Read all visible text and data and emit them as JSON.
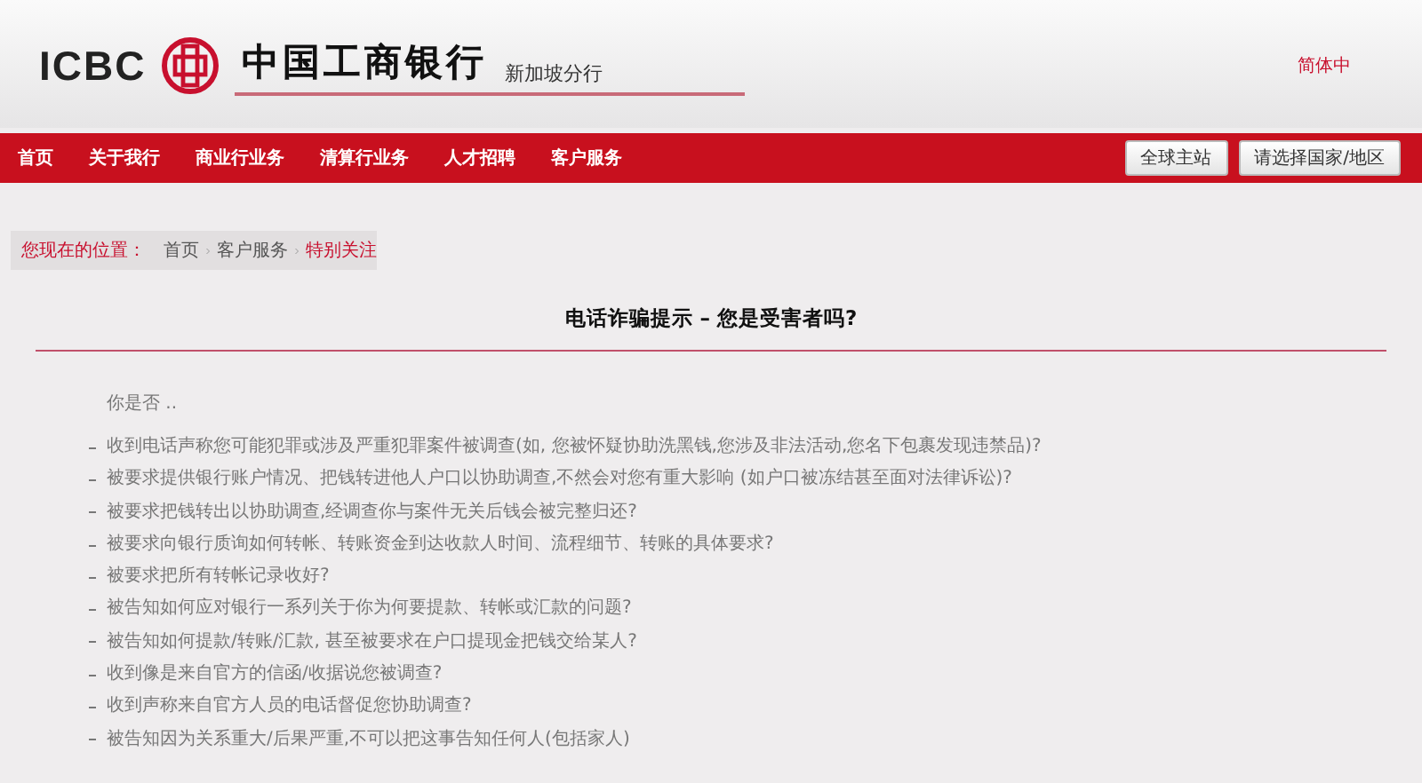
{
  "header": {
    "logo_text": "ICBC",
    "bank_name": "中国工商银行",
    "branch": "新加坡分行",
    "language_link": "简体中"
  },
  "nav": {
    "items": [
      {
        "label": "首页"
      },
      {
        "label": "关于我行"
      },
      {
        "label": "商业行业务"
      },
      {
        "label": "清算行业务"
      },
      {
        "label": "人才招聘"
      },
      {
        "label": "客户服务"
      }
    ],
    "buttons": [
      "全球主站",
      "请选择国家/地区"
    ]
  },
  "breadcrumb": {
    "label": "您现在的位置：",
    "items": [
      {
        "label": "首页",
        "current": false
      },
      {
        "label": "客户服务",
        "current": false
      },
      {
        "label": "特别关注",
        "current": true
      }
    ]
  },
  "article": {
    "title": "电话诈骗提示 – 您是受害者吗?",
    "intro": "你是否 ..",
    "items": [
      "收到电话声称您可能犯罪或涉及严重犯罪案件被调查(如, 您被怀疑协助洗黑钱,您涉及非法活动,您名下包裹发现违禁品)?",
      "被要求提供银行账户情况、把钱转进他人户口以协助调查,不然会对您有重大影响 (如户口被冻结甚至面对法律诉讼)?",
      "被要求把钱转出以协助调查,经调查你与案件无关后钱会被完整归还?",
      "被要求向银行质询如何转帐、转账资金到达收款人时间、流程细节、转账的具体要求?",
      "被要求把所有转帐记录收好?",
      "被告知如何应对银行一系列关于你为何要提款、转帐或汇款的问题?",
      "被告知如何提款/转账/汇款, 甚至被要求在户口提现金把钱交给某人?",
      "收到像是来自官方的信函/收据说您被调查?",
      "收到声称来自官方人员的电话督促您协助调查?",
      "被告知因为关系重大/后果严重,不可以把这事告知任何人(包括家人)"
    ]
  }
}
